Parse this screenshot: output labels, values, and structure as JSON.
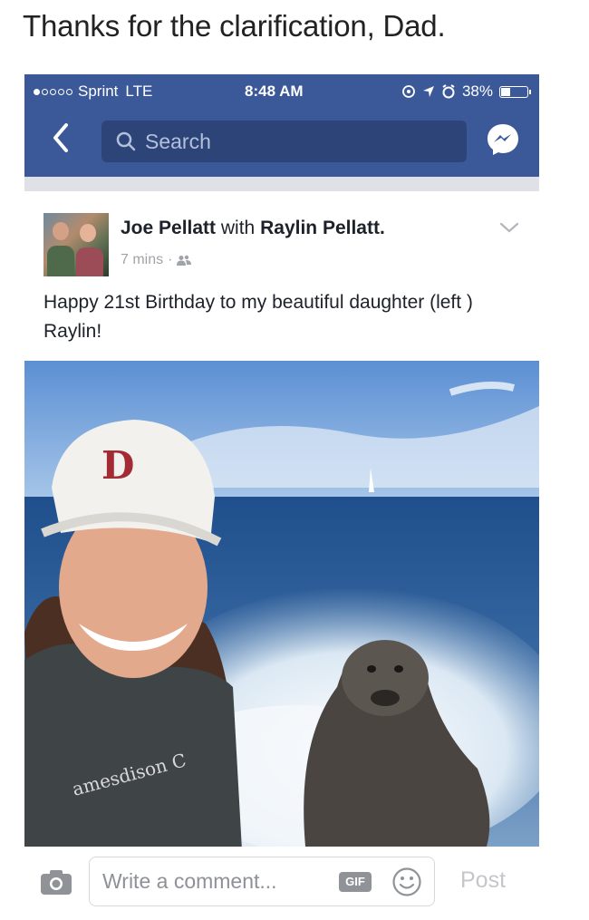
{
  "caption": "Thanks for the clarification, Dad.",
  "status_bar": {
    "carrier": "Sprint",
    "network": "LTE",
    "time": "8:48 AM",
    "battery": "38%",
    "battery_level": 0.38,
    "signal_bars_filled": 1,
    "signal_bars_total": 5
  },
  "nav": {
    "search_placeholder": "Search",
    "back_icon": "chevron-left-icon",
    "messenger_icon": "messenger-icon"
  },
  "post": {
    "author": "Joe Pellatt",
    "with_word": "with",
    "tagged": "Raylin Pellatt.",
    "time": "7 mins",
    "audience_icon": "friends-icon",
    "text": "Happy 21st Birthday to my beautiful daughter (left ) Raylin!",
    "photo_shirt_text": "amesdison C"
  },
  "comment_bar": {
    "placeholder": "Write a comment...",
    "gif_label": "GIF",
    "post_label": "Post"
  },
  "colors": {
    "facebook_blue": "#3b5998",
    "search_bg": "#2c4478"
  }
}
